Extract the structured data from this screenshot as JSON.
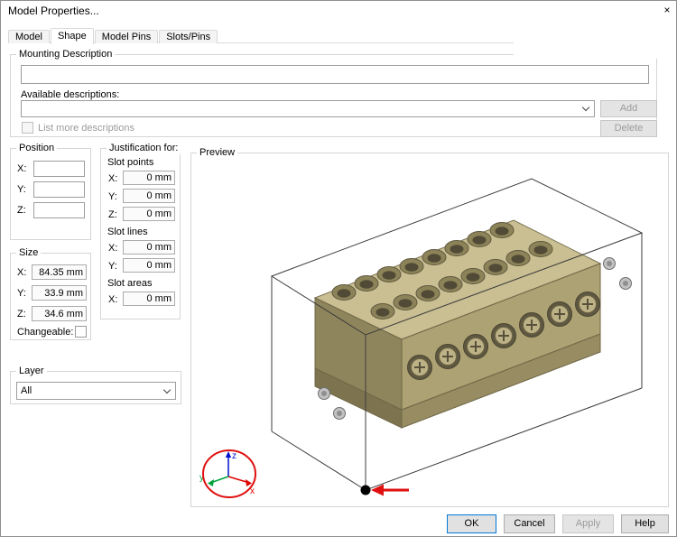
{
  "window": {
    "title": "Model Properties...",
    "close_icon": "×"
  },
  "tabs": [
    {
      "label": "Model"
    },
    {
      "label": "Shape"
    },
    {
      "label": "Model Pins"
    },
    {
      "label": "Slots/Pins"
    }
  ],
  "mounting": {
    "group_label": "Mounting Description",
    "description_value": "",
    "available_label": "Available descriptions:",
    "selected_description": "",
    "add_label": "Add",
    "delete_label": "Delete",
    "list_more_label": "List more descriptions"
  },
  "position": {
    "group_label": "Position",
    "rows": [
      {
        "label": "X:",
        "value": ""
      },
      {
        "label": "Y:",
        "value": ""
      },
      {
        "label": "Z:",
        "value": ""
      }
    ]
  },
  "justification": {
    "group_label": "Justification for:",
    "slot_points": {
      "label": "Slot points",
      "rows": [
        {
          "label": "X:",
          "value": "0 mm"
        },
        {
          "label": "Y:",
          "value": "0 mm"
        },
        {
          "label": "Z:",
          "value": "0 mm"
        }
      ]
    },
    "slot_lines": {
      "label": "Slot lines",
      "rows": [
        {
          "label": "X:",
          "value": "0 mm"
        },
        {
          "label": "Y:",
          "value": "0 mm"
        }
      ]
    },
    "slot_areas": {
      "label": "Slot areas",
      "rows": [
        {
          "label": "X:",
          "value": "0 mm"
        }
      ]
    }
  },
  "size": {
    "group_label": "Size",
    "rows": [
      {
        "label": "X:",
        "value": "84.35 mm"
      },
      {
        "label": "Y:",
        "value": "33.9 mm"
      },
      {
        "label": "Z:",
        "value": "34.6 mm"
      }
    ],
    "changeable_label": "Changeable:"
  },
  "layer": {
    "group_label": "Layer",
    "selected": "All"
  },
  "preview": {
    "group_label": "Preview",
    "axis_labels": {
      "x": "x",
      "y": "y",
      "z": "z"
    }
  },
  "footer": {
    "ok_label": "OK",
    "cancel_label": "Cancel",
    "apply_label": "Apply",
    "help_label": "Help"
  },
  "colors": {
    "accent_blue": "#0078d7",
    "model_tan_light": "#c9bf92",
    "model_tan": "#ada273",
    "model_tan_dark": "#8f855c",
    "axis_x_red": "#e00000",
    "axis_y_green": "#00a33e",
    "axis_z_blue": "#0010d0",
    "annotation_red": "#e01010"
  }
}
